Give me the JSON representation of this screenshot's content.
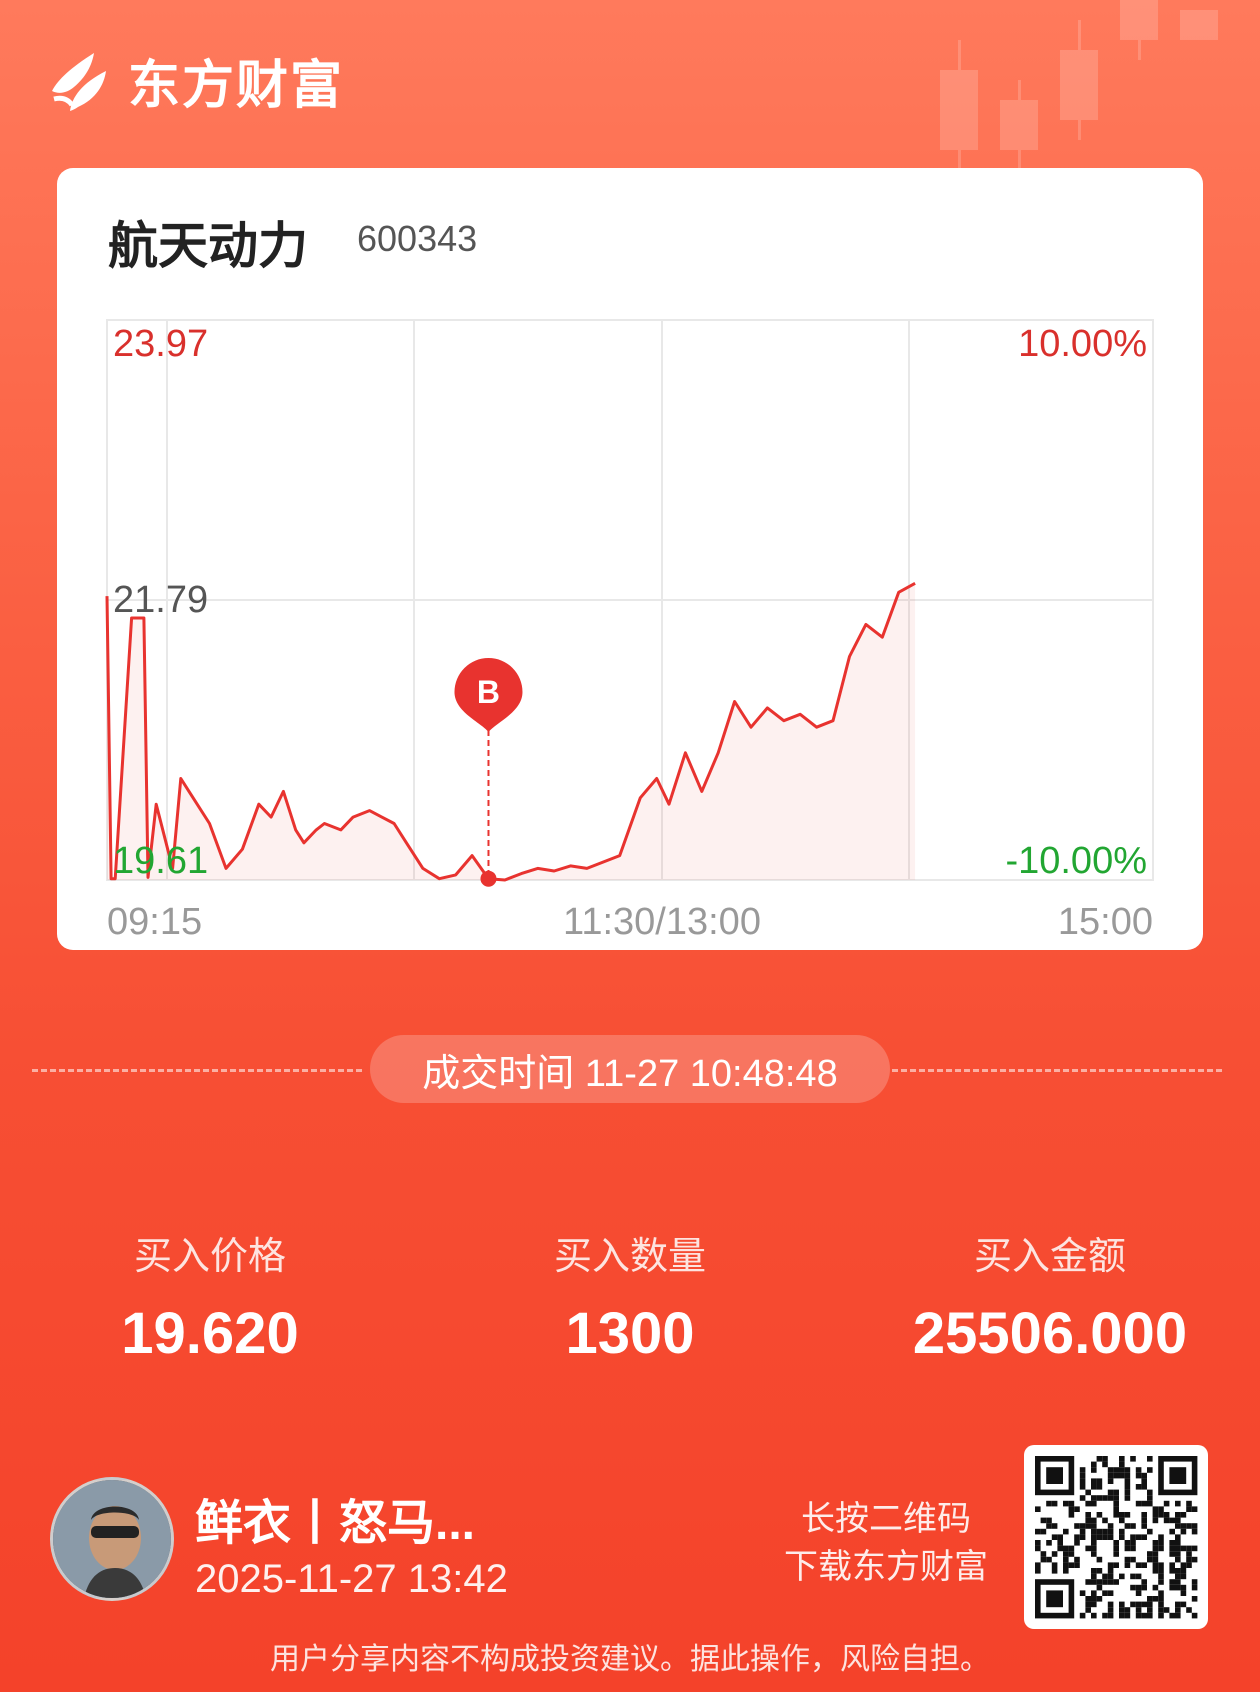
{
  "brand": {
    "name": "东方财富",
    "logo": "eastmoney-logo"
  },
  "stock": {
    "name": "航天动力",
    "code": "600343"
  },
  "chart_data": {
    "type": "line",
    "title": "",
    "ylim": [
      19.61,
      23.97
    ],
    "y_labels": {
      "top": "23.97",
      "mid": "21.79",
      "bottom": "19.61"
    },
    "pct_labels": {
      "top": "10.00%",
      "bottom": "-10.00%"
    },
    "x_ticks": [
      "09:15",
      "11:30/13:00",
      "15:00"
    ],
    "marker": {
      "label": "B",
      "time": "10:48",
      "price": 19.62
    },
    "series": [
      {
        "x": [
          "09:15",
          "09:16",
          "09:17",
          "09:21",
          "09:24",
          "09:25",
          "09:27",
          "09:31",
          "09:33",
          "09:35",
          "09:40",
          "09:44",
          "09:48",
          "09:52",
          "09:55",
          "09:58",
          "10:01",
          "10:03",
          "10:06",
          "10:08",
          "10:12",
          "10:15",
          "10:19",
          "10:22",
          "10:25",
          "10:28",
          "10:32",
          "10:36",
          "10:40",
          "10:44",
          "10:48",
          "10:52",
          "10:56",
          "11:00",
          "11:04",
          "11:08",
          "11:12",
          "11:16",
          "11:20",
          "11:25",
          "11:29",
          "13:02",
          "13:06",
          "13:10",
          "13:14",
          "13:18",
          "13:22",
          "13:26",
          "13:30",
          "13:34",
          "13:38",
          "13:42",
          "13:46",
          "13:50",
          "13:54",
          "13:58",
          "14:02"
        ],
        "y": [
          21.82,
          19.62,
          19.62,
          21.65,
          21.65,
          19.63,
          20.2,
          19.7,
          20.4,
          20.3,
          20.05,
          19.7,
          19.85,
          20.2,
          20.1,
          20.3,
          20.0,
          19.9,
          20.0,
          20.05,
          20.0,
          20.1,
          20.15,
          20.1,
          20.05,
          19.9,
          19.7,
          19.62,
          19.65,
          19.8,
          19.62,
          19.61,
          19.66,
          19.7,
          19.68,
          19.72,
          19.7,
          19.75,
          19.8,
          20.25,
          20.4,
          20.2,
          20.6,
          20.3,
          20.6,
          21.0,
          20.8,
          20.95,
          20.85,
          20.9,
          20.8,
          20.85,
          21.35,
          21.6,
          21.5,
          21.85,
          21.92
        ]
      }
    ]
  },
  "trade": {
    "time_text": "成交时间 11-27 10:48:48",
    "price_label": "买入价格",
    "price": "19.620",
    "qty_label": "买入数量",
    "qty": "1300",
    "amount_label": "买入金额",
    "amount": "25506.000"
  },
  "user": {
    "name": "鲜衣丨怒马...",
    "share_time": "2025-11-27 13:42"
  },
  "qr": {
    "hint_line1": "长按二维码",
    "hint_line2": "下载东方财富"
  },
  "disclaimer": "用户分享内容不构成投资建议。据此操作，风险自担。",
  "colors": {
    "up": "#e8332f",
    "down": "#22a632",
    "grid": "#e8e8e8"
  }
}
